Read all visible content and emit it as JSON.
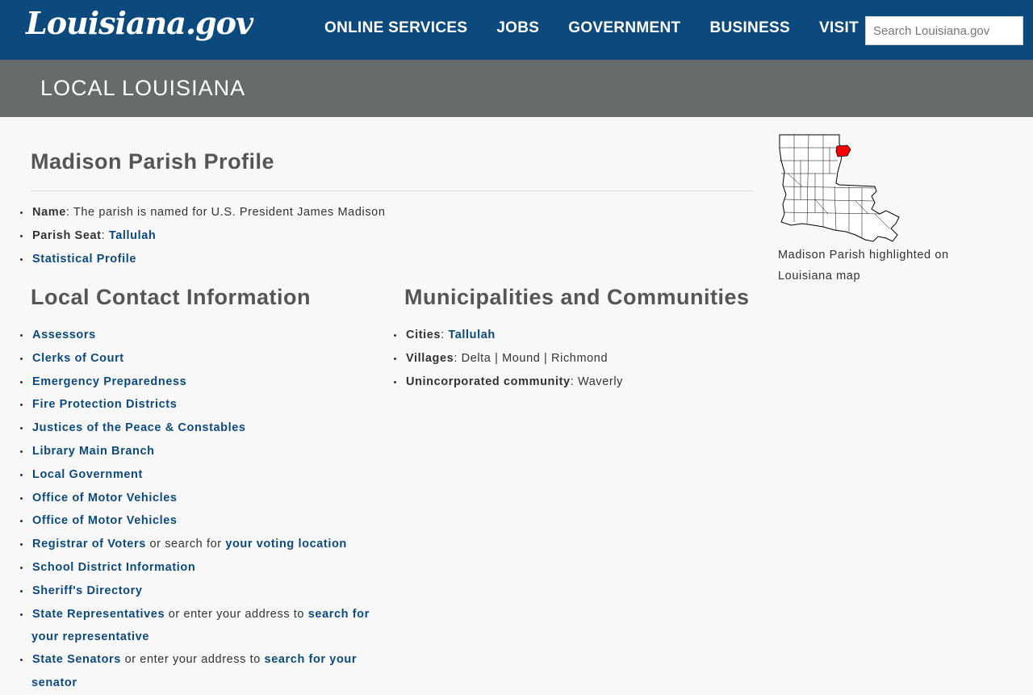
{
  "header": {
    "logo": "Louisiana.gov",
    "nav": [
      "ONLINE SERVICES",
      "JOBS",
      "GOVERNMENT",
      "BUSINESS",
      "VISIT"
    ],
    "search_placeholder": "Search Louisiana.gov"
  },
  "subheader": {
    "title": "LOCAL LOUISIANA"
  },
  "profile": {
    "title": "Madison Parish Profile",
    "name_label": "Name",
    "name_value": ": The parish is named for U.S. President James Madison",
    "seat_label": "Parish Seat",
    "seat_sep": ": ",
    "seat_value": "Tallulah",
    "stat_profile": "Statistical Profile"
  },
  "contacts": {
    "title": "Local Contact Information",
    "items": [
      "Assessors",
      "Clerks of Court",
      "Emergency Preparedness",
      "Fire Protection Districts",
      "Justices of the Peace & Constables",
      "Library Main Branch",
      "Local Government",
      "Office of Motor Vehicles",
      "Office of Motor Vehicles"
    ],
    "registrar": {
      "link": "Registrar of Voters",
      "text": " or search for ",
      "link2": "your voting location"
    },
    "items2": [
      "School District Information",
      "Sheriff's Directory"
    ],
    "reps": {
      "link": "State Representatives",
      "text": " or enter your address to ",
      "link2": "search for your representative"
    },
    "senators": {
      "link": "State Senators",
      "text": " or enter your address to ",
      "link2": "search for your senator"
    }
  },
  "municipalities": {
    "title": "Municipalities and Communities",
    "cities_label": "Cities",
    "cities_sep": ": ",
    "cities_value": "Tallulah",
    "villages_label": "Villages",
    "villages_value": ": Delta | Mound | Richmond",
    "unincorporated_label": "Unincorporated community",
    "unincorporated_value": ": Waverly"
  },
  "map": {
    "caption": "Madison Parish highlighted on Louisiana map",
    "highlight_color": "#ff0000"
  },
  "colors": {
    "header_bg": "#0c4a7e",
    "subheader_bg": "#666b6b",
    "link": "#0c4a7e"
  }
}
